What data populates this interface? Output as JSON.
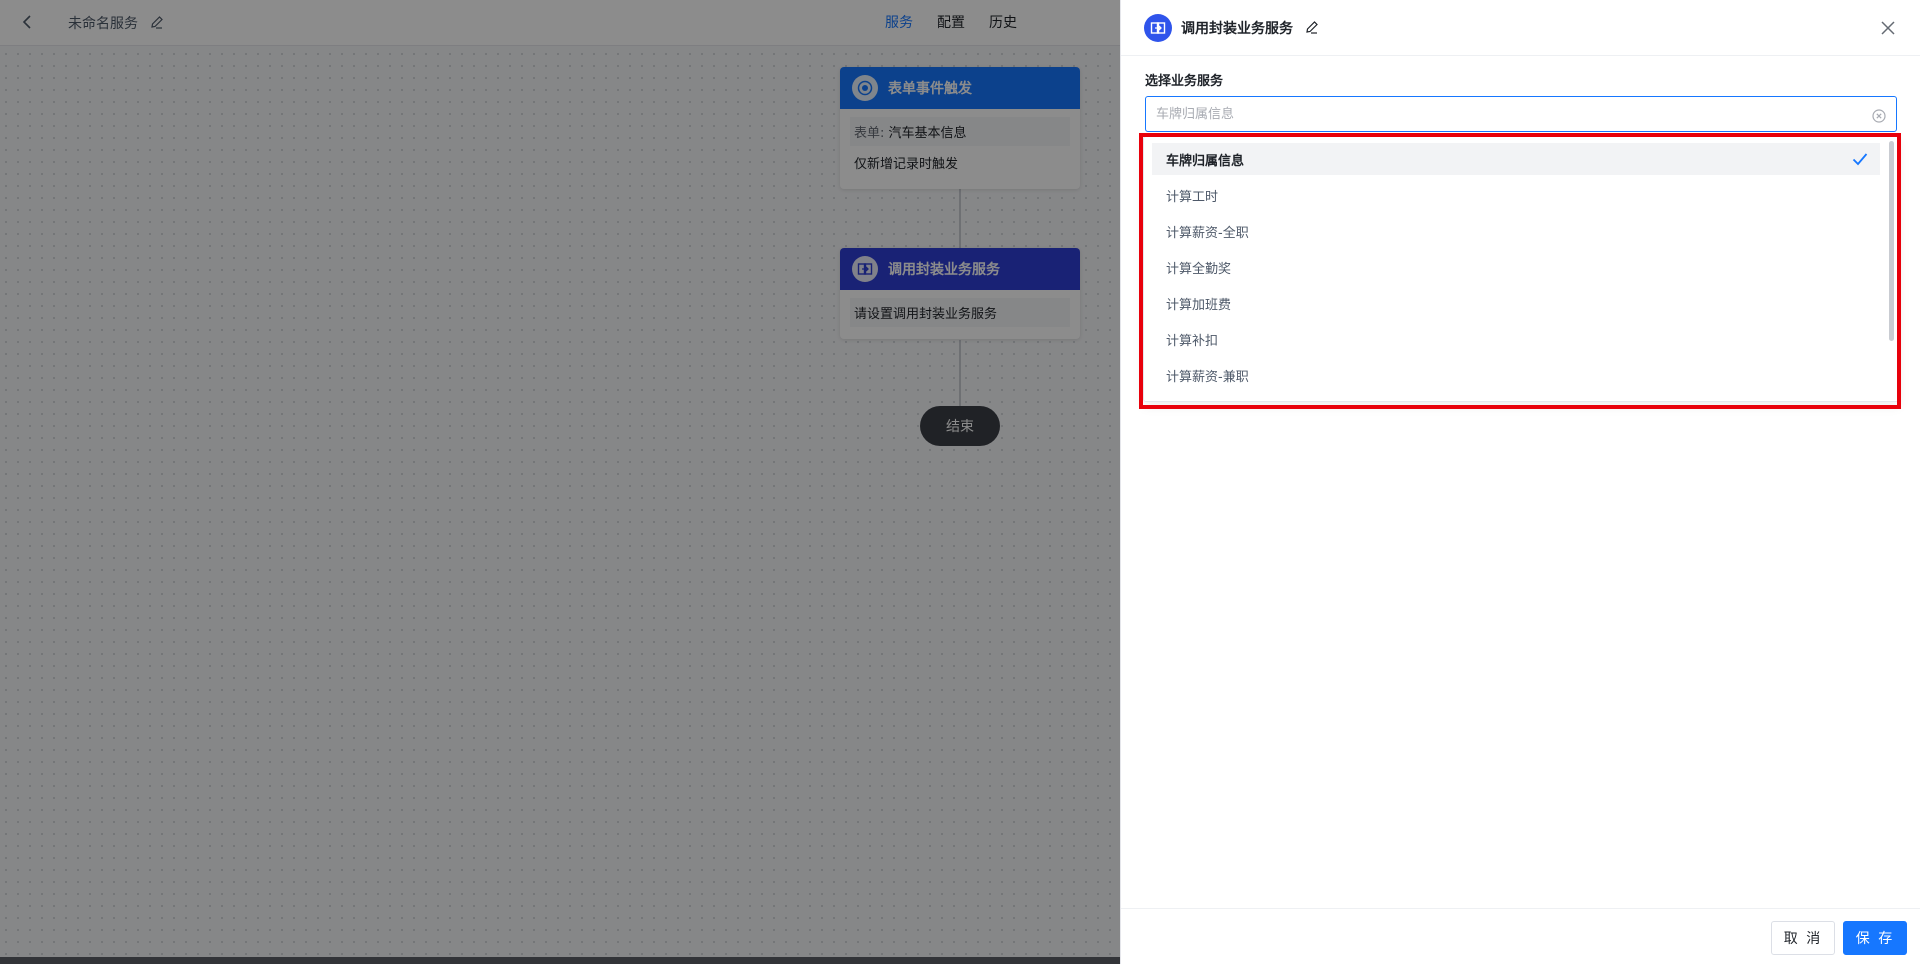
{
  "topbar": {
    "service_name": "未命名服务",
    "tabs": [
      {
        "label": "服务",
        "active": true
      },
      {
        "label": "配置",
        "active": false
      },
      {
        "label": "历史",
        "active": false
      }
    ]
  },
  "flow": {
    "trigger_node": {
      "title": "表单事件触发",
      "form_label": "表单:",
      "form_value": "汽车基本信息",
      "condition": "仅新增记录时触发",
      "color": "#1677ff"
    },
    "service_node": {
      "title": "调用封装业务服务",
      "placeholder": "请设置调用封装业务服务",
      "color": "#2f3fd6"
    },
    "end_node": {
      "label": "结束"
    }
  },
  "drawer": {
    "title": "调用封装业务服务",
    "field_label": "选择业务服务",
    "select": {
      "placeholder": "车牌归属信息",
      "value": ""
    },
    "options": [
      {
        "label": "车牌归属信息",
        "selected": true
      },
      {
        "label": "计算工时",
        "selected": false
      },
      {
        "label": "计算薪资-全职",
        "selected": false
      },
      {
        "label": "计算全勤奖",
        "selected": false
      },
      {
        "label": "计算加班费",
        "selected": false
      },
      {
        "label": "计算补扣",
        "selected": false
      },
      {
        "label": "计算薪资-兼职",
        "selected": false
      }
    ],
    "buttons": {
      "cancel": "取 消",
      "save": "保 存"
    },
    "accent_color": "#1677ff",
    "highlight_color": "#e8000b"
  }
}
